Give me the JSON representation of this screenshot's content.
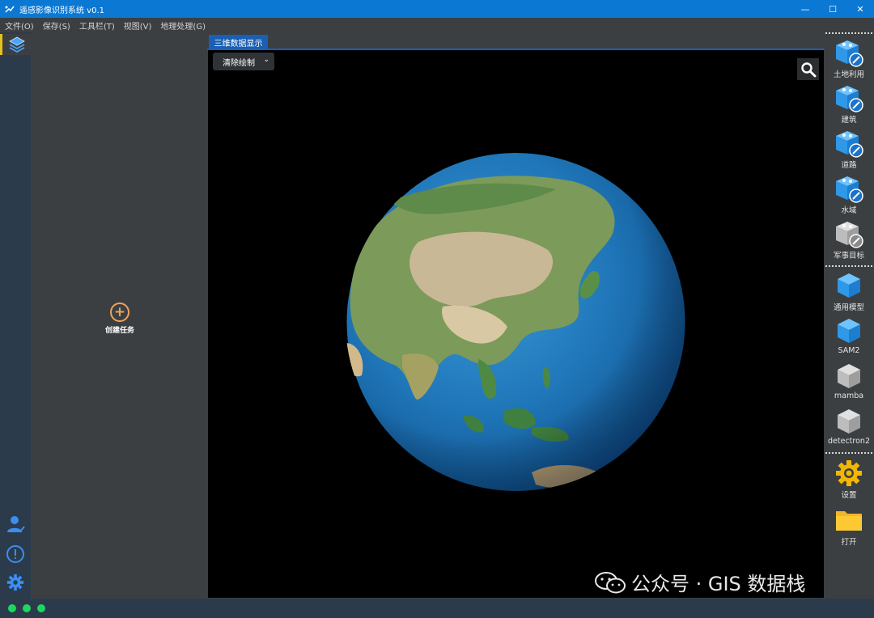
{
  "window": {
    "title": "遥感影像识别系统 v0.1",
    "controls": {
      "minimize": "—",
      "maximize": "☐",
      "close": "✕"
    }
  },
  "menu": [
    "文件(O)",
    "保存(S)",
    "工具栏(T)",
    "视图(V)",
    "地理处理(G)"
  ],
  "left_strip": {
    "top_icon": "layers-icon",
    "bottom_icons": [
      "user-icon",
      "alert-icon",
      "settings-icon"
    ]
  },
  "task_panel": {
    "create_label": "创建任务"
  },
  "viewer": {
    "tab_label": "三维数据显示",
    "clear_select": {
      "value": "清除绘制"
    },
    "search_icon": "search-icon"
  },
  "right_toolbar": {
    "group1": [
      {
        "label": "土地利用",
        "icon": "blue-cube-edit-icon"
      },
      {
        "label": "建筑",
        "icon": "blue-cube-edit-icon"
      },
      {
        "label": "道路",
        "icon": "blue-cube-edit-icon"
      },
      {
        "label": "水域",
        "icon": "blue-cube-edit-icon"
      },
      {
        "label": "军事目标",
        "icon": "gray-cube-edit-icon"
      }
    ],
    "group2": [
      {
        "label": "通用模型",
        "icon": "blue-box-icon"
      },
      {
        "label": "SAM2",
        "icon": "blue-box-icon"
      },
      {
        "label": "mamba",
        "icon": "gray-box-icon"
      },
      {
        "label": "detectron2",
        "icon": "gray-box-icon"
      }
    ],
    "group3": [
      {
        "label": "设置",
        "icon": "gear-icon"
      },
      {
        "label": "打开",
        "icon": "folder-icon"
      }
    ]
  },
  "watermark": {
    "text": "公众号 · GIS 数据栈"
  },
  "status": {
    "indicator_count": 3,
    "indicator_color": "#1ed760"
  },
  "colors": {
    "titlebar": "#0b78d4",
    "accent": "#1a5fb4",
    "panel": "#3c3f41",
    "strip": "#2b3b4c"
  }
}
